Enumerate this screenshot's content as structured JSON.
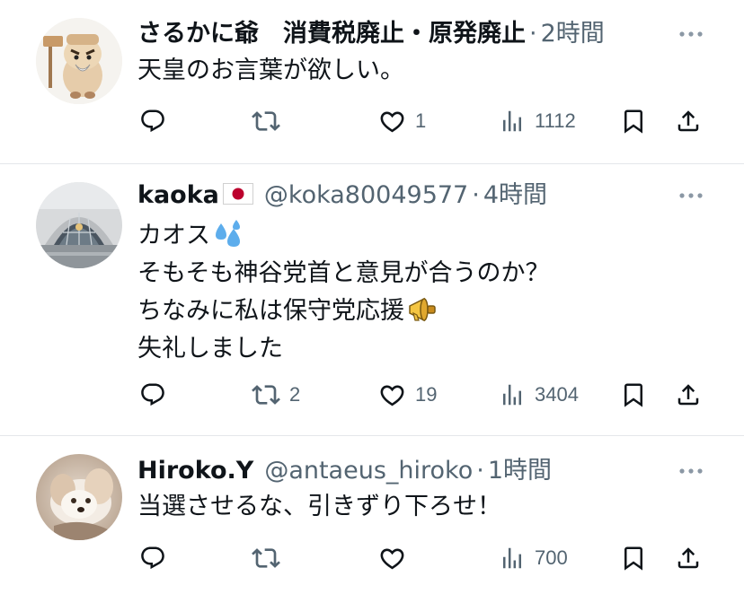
{
  "tweets": [
    {
      "name": "さるかに爺　消費税廃止・原発廃止",
      "handle": "",
      "time": "2時間",
      "lines": [
        "天皇のお言葉が欲しい。"
      ],
      "stats": {
        "replies": "",
        "retweets": "",
        "likes": "1",
        "views": "1112"
      }
    },
    {
      "name": "kaoka",
      "handle": "@koka80049577",
      "time": "4時間",
      "lines": [
        "カオス",
        "そもそも神谷党首と意見が合うのか？",
        "ちなみに私は保守党応援",
        "失礼しました"
      ],
      "stats": {
        "replies": "",
        "retweets": "2",
        "likes": "19",
        "views": "3404"
      }
    },
    {
      "name": "Hiroko.Y",
      "handle": "@antaeus_hiroko",
      "time": "1時間",
      "lines": [
        "当選させるな、引きずり下ろせ！"
      ],
      "stats": {
        "replies": "",
        "retweets": "",
        "likes": "",
        "views": "700"
      }
    }
  ],
  "icons": {
    "reply": "reply-icon",
    "retweet": "retweet-icon",
    "like": "heart-icon",
    "views": "views-icon",
    "bookmark": "bookmark-icon",
    "share": "share-icon",
    "more": "more-icon",
    "flag": "japan-flag-icon",
    "sweat": "sweat-droplets-icon",
    "megaphone": "megaphone-icon"
  },
  "colors": {
    "text": "#0f1419",
    "secondary": "#536471",
    "divider": "#e4e7ea"
  }
}
